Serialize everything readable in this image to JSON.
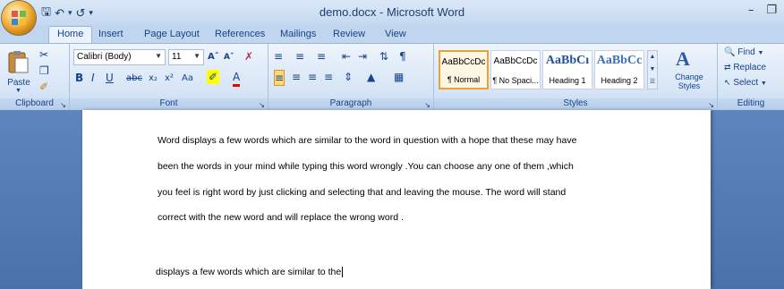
{
  "window": {
    "title": "demo.docx - Microsoft Word"
  },
  "quick_access": {
    "icons": [
      "save-icon",
      "undo-icon",
      "redo-icon",
      "customize-icon"
    ]
  },
  "tabs": [
    "Home",
    "Insert",
    "Page Layout",
    "References",
    "Mailings",
    "Review",
    "View"
  ],
  "ribbon": {
    "clipboard": {
      "label": "Clipboard",
      "paste_label": "Paste"
    },
    "font": {
      "label": "Font",
      "font_name": "Calibri (Body)",
      "font_size": "11"
    },
    "paragraph": {
      "label": "Paragraph"
    },
    "styles": {
      "label": "Styles",
      "items": [
        {
          "preview": "AaBbCcDc",
          "name": "¶ Normal"
        },
        {
          "preview": "AaBbCcDc",
          "name": "¶ No Spaci..."
        },
        {
          "preview": "AaBbCı",
          "name": "Heading 1"
        },
        {
          "preview": "AaBbCc",
          "name": "Heading 2"
        }
      ],
      "change_styles": "Change Styles"
    },
    "editing": {
      "label": "Editing",
      "find": "Find",
      "replace": "Replace",
      "select": "Select"
    }
  },
  "document": {
    "lines": [
      "Word displays a few words which are similar to the word in question with a hope that these may have",
      "been the words in your mind while typing this word wrongly .You can choose any one of them ,which",
      "you feel  is right word by just clicking and selecting that and leaving the mouse. The word will stand",
      "correct with the new word and will replace the wrong word ."
    ],
    "typing_line": "displays a few words which are similar to the"
  }
}
